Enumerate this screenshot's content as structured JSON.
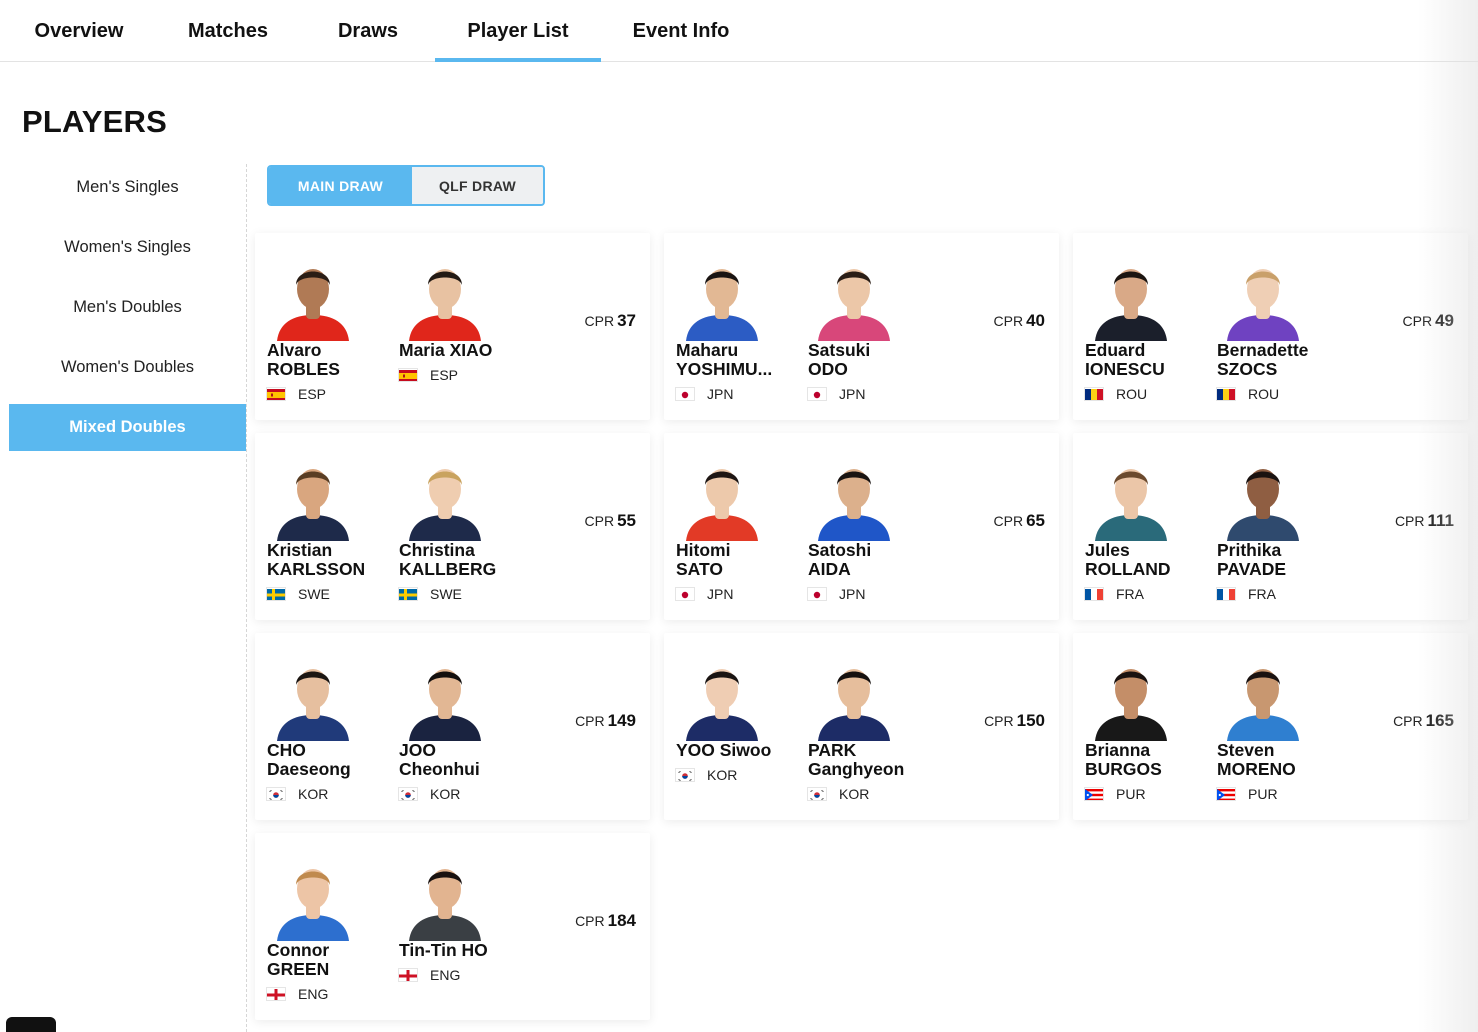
{
  "tabs": [
    "Overview",
    "Matches",
    "Draws",
    "Player List",
    "Event Info"
  ],
  "active_tab": "Player List",
  "page_title": "PLAYERS",
  "sidebar": {
    "items": [
      "Men's Singles",
      "Women's Singles",
      "Men's Doubles",
      "Women's Doubles",
      "Mixed Doubles"
    ],
    "active": "Mixed Doubles"
  },
  "draw_toggle": {
    "main": "MAIN DRAW",
    "qlf": "QLF DRAW",
    "active": "MAIN DRAW"
  },
  "cpr_label": "CPR",
  "pairs": [
    {
      "cpr": "37",
      "players": [
        {
          "first": "Alvaro",
          "last": "ROBLES",
          "country": "ESP",
          "flag": "esp",
          "shirt": "#e0261b",
          "skin": "#b07a55",
          "hair": "#2a1d15"
        },
        {
          "first": "Maria XIAO",
          "last": "",
          "country": "ESP",
          "flag": "esp",
          "shirt": "#e0261b",
          "skin": "#e8c2a2",
          "hair": "#231a14"
        }
      ]
    },
    {
      "cpr": "40",
      "players": [
        {
          "first": "Maharu",
          "last": "YOSHIMU...",
          "country": "JPN",
          "flag": "jpn",
          "shirt": "#2c5cc4",
          "skin": "#e2b894",
          "hair": "#1a1412"
        },
        {
          "first": "Satsuki",
          "last": "ODO",
          "country": "JPN",
          "flag": "jpn",
          "shirt": "#d8477a",
          "skin": "#ecc7a8",
          "hair": "#2b1e16"
        }
      ]
    },
    {
      "cpr": "49",
      "players": [
        {
          "first": "Eduard",
          "last": "IONESCU",
          "country": "ROU",
          "flag": "rou",
          "shirt": "#1b1f2b",
          "skin": "#d9a987",
          "hair": "#1c1511"
        },
        {
          "first": "Bernadette",
          "last": "SZOCS",
          "country": "ROU",
          "flag": "rou",
          "shirt": "#6f42c1",
          "skin": "#efcfb5",
          "hair": "#c9a06a"
        }
      ]
    },
    {
      "cpr": "55",
      "players": [
        {
          "first": "Kristian",
          "last": "KARLSSON",
          "country": "SWE",
          "flag": "swe",
          "shirt": "#1e2a4a",
          "skin": "#d9a67f",
          "hair": "#5a3e24"
        },
        {
          "first": "Christina",
          "last": "KALLBERG",
          "country": "SWE",
          "flag": "swe",
          "shirt": "#1e2a4a",
          "skin": "#efcdb0",
          "hair": "#c9a35f"
        }
      ]
    },
    {
      "cpr": "65",
      "players": [
        {
          "first": "Hitomi",
          "last": "SATO",
          "country": "JPN",
          "flag": "jpn",
          "shirt": "#e23a26",
          "skin": "#edc9ab",
          "hair": "#1e1613"
        },
        {
          "first": "Satoshi",
          "last": "AIDA",
          "country": "JPN",
          "flag": "jpn",
          "shirt": "#1f56c8",
          "skin": "#dcb08c",
          "hair": "#1a1412"
        }
      ]
    },
    {
      "cpr": "111",
      "players": [
        {
          "first": "Jules",
          "last": "ROLLAND",
          "country": "FRA",
          "flag": "fra",
          "shirt": "#2a6a7a",
          "skin": "#ebc6a8",
          "hair": "#6b4a2e"
        },
        {
          "first": "Prithika",
          "last": "PAVADE",
          "country": "FRA",
          "flag": "fra",
          "shirt": "#2f4a6e",
          "skin": "#8f5e42",
          "hair": "#1a1210"
        }
      ]
    },
    {
      "cpr": "149",
      "players": [
        {
          "first": "CHO",
          "last": "Daeseong",
          "country": "KOR",
          "flag": "kor",
          "shirt": "#203a7a",
          "skin": "#e6bf9f",
          "hair": "#1c1612"
        },
        {
          "first": "JOO",
          "last": "Cheonhui",
          "country": "KOR",
          "flag": "kor",
          "shirt": "#1a2340",
          "skin": "#e2b794",
          "hair": "#14100e"
        }
      ]
    },
    {
      "cpr": "150",
      "players": [
        {
          "first": "YOO Siwoo",
          "last": "",
          "country": "KOR",
          "flag": "kor",
          "shirt": "#1d2c66",
          "skin": "#efcdb3",
          "hair": "#1a1412"
        },
        {
          "first": "PARK",
          "last": "Ganghyeon",
          "country": "KOR",
          "flag": "kor",
          "shirt": "#1d2c66",
          "skin": "#e6be9c",
          "hair": "#16110f"
        }
      ]
    },
    {
      "cpr": "165",
      "players": [
        {
          "first": "Brianna",
          "last": "BURGOS",
          "country": "PUR",
          "flag": "pur",
          "shirt": "#181818",
          "skin": "#c48e68",
          "hair": "#1a1210"
        },
        {
          "first": "Steven",
          "last": "MORENO",
          "country": "PUR",
          "flag": "pur",
          "shirt": "#2f7fd0",
          "skin": "#c89770",
          "hair": "#1a1210"
        }
      ]
    },
    {
      "cpr": "184",
      "players": [
        {
          "first": "Connor",
          "last": "GREEN",
          "country": "ENG",
          "flag": "eng",
          "shirt": "#2d6fcf",
          "skin": "#edc5a6",
          "hair": "#c08a4e"
        },
        {
          "first": "Tin-Tin HO",
          "last": "",
          "country": "ENG",
          "flag": "eng",
          "shirt": "#3a3f44",
          "skin": "#e2b490",
          "hair": "#1a1210"
        }
      ]
    }
  ]
}
